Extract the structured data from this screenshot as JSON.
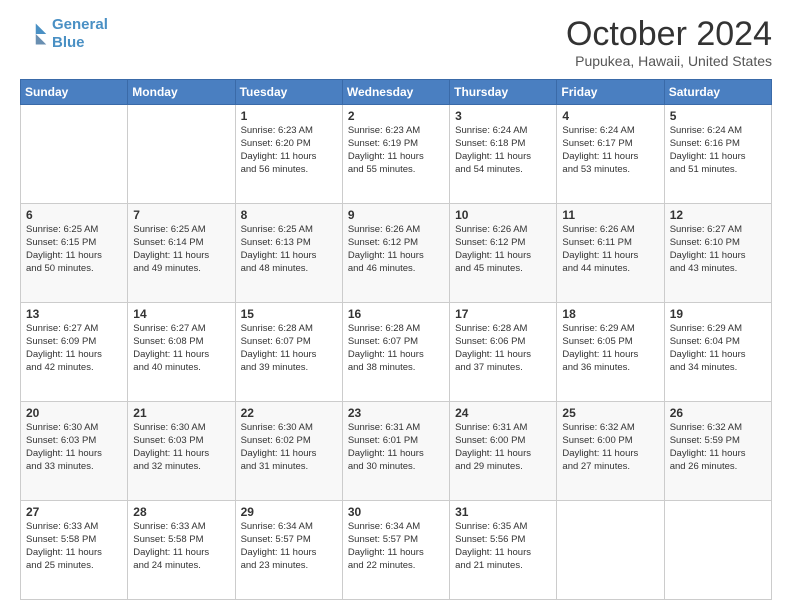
{
  "header": {
    "logo_line1": "General",
    "logo_line2": "Blue",
    "month": "October 2024",
    "location": "Pupukea, Hawaii, United States"
  },
  "weekdays": [
    "Sunday",
    "Monday",
    "Tuesday",
    "Wednesday",
    "Thursday",
    "Friday",
    "Saturday"
  ],
  "weeks": [
    [
      {
        "day": "",
        "info": ""
      },
      {
        "day": "",
        "info": ""
      },
      {
        "day": "1",
        "info": "Sunrise: 6:23 AM\nSunset: 6:20 PM\nDaylight: 11 hours\nand 56 minutes."
      },
      {
        "day": "2",
        "info": "Sunrise: 6:23 AM\nSunset: 6:19 PM\nDaylight: 11 hours\nand 55 minutes."
      },
      {
        "day": "3",
        "info": "Sunrise: 6:24 AM\nSunset: 6:18 PM\nDaylight: 11 hours\nand 54 minutes."
      },
      {
        "day": "4",
        "info": "Sunrise: 6:24 AM\nSunset: 6:17 PM\nDaylight: 11 hours\nand 53 minutes."
      },
      {
        "day": "5",
        "info": "Sunrise: 6:24 AM\nSunset: 6:16 PM\nDaylight: 11 hours\nand 51 minutes."
      }
    ],
    [
      {
        "day": "6",
        "info": "Sunrise: 6:25 AM\nSunset: 6:15 PM\nDaylight: 11 hours\nand 50 minutes."
      },
      {
        "day": "7",
        "info": "Sunrise: 6:25 AM\nSunset: 6:14 PM\nDaylight: 11 hours\nand 49 minutes."
      },
      {
        "day": "8",
        "info": "Sunrise: 6:25 AM\nSunset: 6:13 PM\nDaylight: 11 hours\nand 48 minutes."
      },
      {
        "day": "9",
        "info": "Sunrise: 6:26 AM\nSunset: 6:12 PM\nDaylight: 11 hours\nand 46 minutes."
      },
      {
        "day": "10",
        "info": "Sunrise: 6:26 AM\nSunset: 6:12 PM\nDaylight: 11 hours\nand 45 minutes."
      },
      {
        "day": "11",
        "info": "Sunrise: 6:26 AM\nSunset: 6:11 PM\nDaylight: 11 hours\nand 44 minutes."
      },
      {
        "day": "12",
        "info": "Sunrise: 6:27 AM\nSunset: 6:10 PM\nDaylight: 11 hours\nand 43 minutes."
      }
    ],
    [
      {
        "day": "13",
        "info": "Sunrise: 6:27 AM\nSunset: 6:09 PM\nDaylight: 11 hours\nand 42 minutes."
      },
      {
        "day": "14",
        "info": "Sunrise: 6:27 AM\nSunset: 6:08 PM\nDaylight: 11 hours\nand 40 minutes."
      },
      {
        "day": "15",
        "info": "Sunrise: 6:28 AM\nSunset: 6:07 PM\nDaylight: 11 hours\nand 39 minutes."
      },
      {
        "day": "16",
        "info": "Sunrise: 6:28 AM\nSunset: 6:07 PM\nDaylight: 11 hours\nand 38 minutes."
      },
      {
        "day": "17",
        "info": "Sunrise: 6:28 AM\nSunset: 6:06 PM\nDaylight: 11 hours\nand 37 minutes."
      },
      {
        "day": "18",
        "info": "Sunrise: 6:29 AM\nSunset: 6:05 PM\nDaylight: 11 hours\nand 36 minutes."
      },
      {
        "day": "19",
        "info": "Sunrise: 6:29 AM\nSunset: 6:04 PM\nDaylight: 11 hours\nand 34 minutes."
      }
    ],
    [
      {
        "day": "20",
        "info": "Sunrise: 6:30 AM\nSunset: 6:03 PM\nDaylight: 11 hours\nand 33 minutes."
      },
      {
        "day": "21",
        "info": "Sunrise: 6:30 AM\nSunset: 6:03 PM\nDaylight: 11 hours\nand 32 minutes."
      },
      {
        "day": "22",
        "info": "Sunrise: 6:30 AM\nSunset: 6:02 PM\nDaylight: 11 hours\nand 31 minutes."
      },
      {
        "day": "23",
        "info": "Sunrise: 6:31 AM\nSunset: 6:01 PM\nDaylight: 11 hours\nand 30 minutes."
      },
      {
        "day": "24",
        "info": "Sunrise: 6:31 AM\nSunset: 6:00 PM\nDaylight: 11 hours\nand 29 minutes."
      },
      {
        "day": "25",
        "info": "Sunrise: 6:32 AM\nSunset: 6:00 PM\nDaylight: 11 hours\nand 27 minutes."
      },
      {
        "day": "26",
        "info": "Sunrise: 6:32 AM\nSunset: 5:59 PM\nDaylight: 11 hours\nand 26 minutes."
      }
    ],
    [
      {
        "day": "27",
        "info": "Sunrise: 6:33 AM\nSunset: 5:58 PM\nDaylight: 11 hours\nand 25 minutes."
      },
      {
        "day": "28",
        "info": "Sunrise: 6:33 AM\nSunset: 5:58 PM\nDaylight: 11 hours\nand 24 minutes."
      },
      {
        "day": "29",
        "info": "Sunrise: 6:34 AM\nSunset: 5:57 PM\nDaylight: 11 hours\nand 23 minutes."
      },
      {
        "day": "30",
        "info": "Sunrise: 6:34 AM\nSunset: 5:57 PM\nDaylight: 11 hours\nand 22 minutes."
      },
      {
        "day": "31",
        "info": "Sunrise: 6:35 AM\nSunset: 5:56 PM\nDaylight: 11 hours\nand 21 minutes."
      },
      {
        "day": "",
        "info": ""
      },
      {
        "day": "",
        "info": ""
      }
    ]
  ]
}
